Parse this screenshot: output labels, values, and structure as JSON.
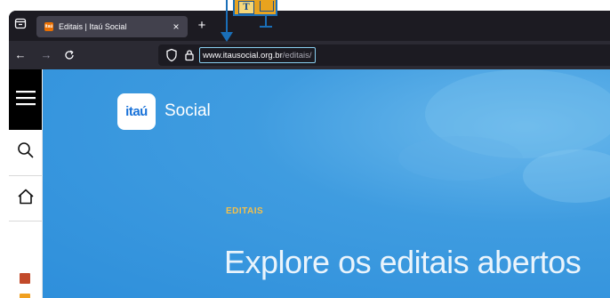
{
  "tab": {
    "favicon_text": "itaú",
    "title": "Editais | Itaú Social",
    "close_glyph": "×",
    "new_tab_glyph": "+"
  },
  "nav": {
    "back_glyph": "←",
    "forward_glyph": "→",
    "reload_glyph": "↻"
  },
  "url": {
    "host": "www.itausocial.org.br",
    "path": "/editais/"
  },
  "page": {
    "logo_text": "itaú",
    "brand_suffix": "Social",
    "section_label": "EDITAIS",
    "headline": "Explore os editais abertos"
  },
  "annotation": {
    "badge_letter": "T"
  },
  "icons": {
    "tabs_list": "tabs-list-icon",
    "shield": "tracking-protection-shield-icon",
    "lock": "lock-icon",
    "menu": "hamburger-menu-icon",
    "search": "search-icon",
    "home": "home-icon"
  },
  "colors": {
    "hero_blue": "#3f9ce0",
    "brand_blue": "#1a73d9",
    "section_label": "#f5c04a",
    "square_1": "#c24a2a",
    "square_2": "#f0a020",
    "annotation_blue": "#1a6fb8",
    "annotation_orange": "#e8a31f"
  }
}
